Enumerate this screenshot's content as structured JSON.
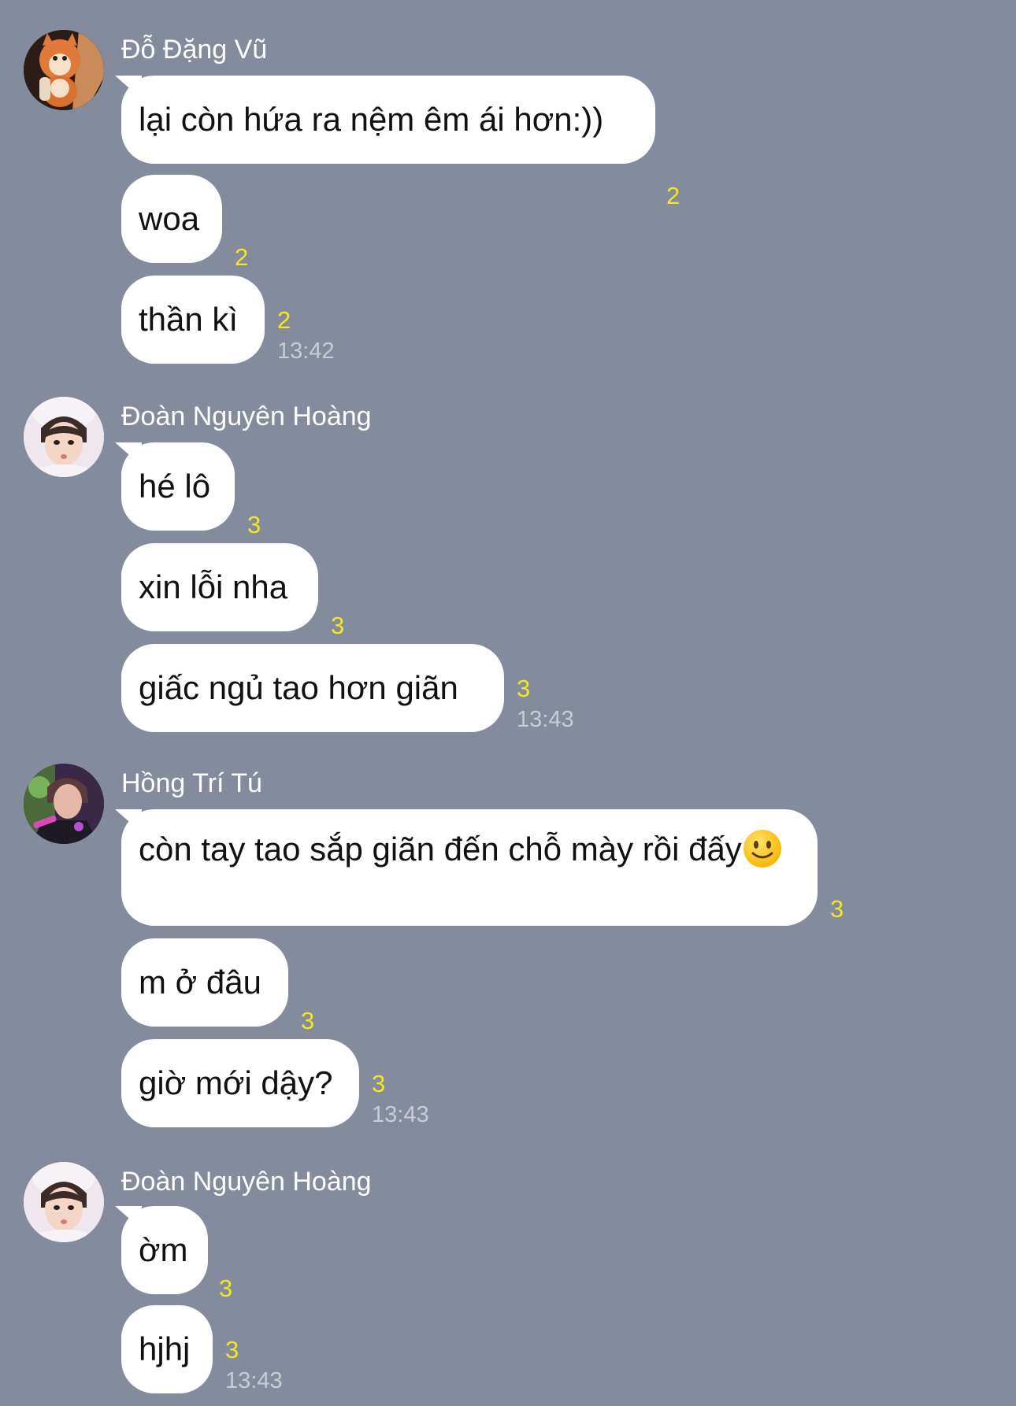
{
  "groups": [
    {
      "sender": "Đỗ Đặng Vũ",
      "avatar": "fox-plush-avatar",
      "messages": [
        {
          "text": "lại còn hứa ra nệm êm ái hơn:))",
          "read": "2"
        },
        {
          "text": "woa",
          "read": "2"
        },
        {
          "text": "thần kì",
          "read": "2",
          "time": "13:42"
        }
      ]
    },
    {
      "sender": "Đoàn Nguyên Hoàng",
      "avatar": "person-avatar",
      "messages": [
        {
          "text": "hé lô",
          "read": "3"
        },
        {
          "text": "xin lỗi nha",
          "read": "3"
        },
        {
          "text": "giấc ngủ tao hơn giãn",
          "read": "3",
          "time": "13:43"
        }
      ]
    },
    {
      "sender": "Hồng Trí Tú",
      "avatar": "performer-avatar",
      "messages": [
        {
          "text": "còn tay tao sắp giãn đến chỗ mày rồi đấy",
          "emoji": "slightly-smiling-face",
          "read": "3"
        },
        {
          "text": "m ở đâu",
          "read": "3"
        },
        {
          "text": "giờ mới dậy?",
          "read": "3",
          "time": "13:43"
        }
      ]
    },
    {
      "sender": "Đoàn Nguyên Hoàng",
      "avatar": "person-avatar",
      "messages": [
        {
          "text": "ờm",
          "read": "3"
        },
        {
          "text": "hjhj",
          "read": "3",
          "time": "13:43"
        }
      ]
    }
  ],
  "colors": {
    "background": "#838b9d",
    "bubble": "#ffffff",
    "read_count": "#f5e61e",
    "timestamp": "#c8ccd4"
  }
}
